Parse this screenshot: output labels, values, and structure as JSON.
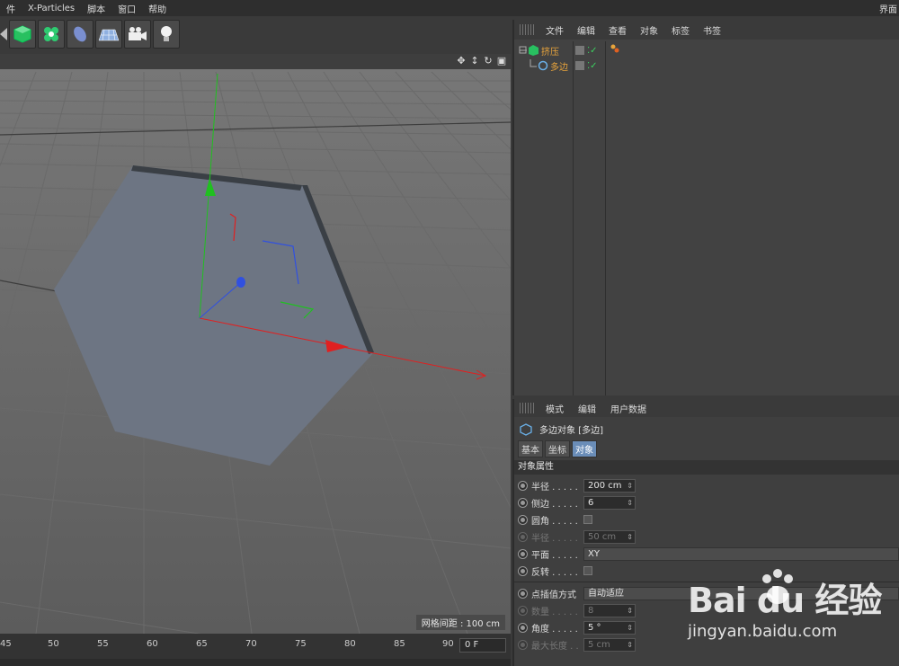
{
  "menu": {
    "items": [
      "件",
      "X-Particles",
      "脚本",
      "窗口",
      "帮助"
    ],
    "right_label": "界面"
  },
  "toolbar": {
    "icons": [
      "extrude-cube-icon",
      "cloner-icon",
      "deformer-icon",
      "floor-grid-icon",
      "camera-icon",
      "light-icon"
    ]
  },
  "viewport": {
    "grid_label": "网格间距 : 100 cm",
    "nav_icons": [
      "move-icon",
      "zoom-icon",
      "rotate-icon",
      "maximize-icon"
    ]
  },
  "timeline": {
    "ticks": [
      "45",
      "50",
      "55",
      "60",
      "65",
      "70",
      "75",
      "80",
      "85",
      "90"
    ],
    "frame_value": "0 F"
  },
  "object_manager": {
    "menu": [
      "文件",
      "编辑",
      "查看",
      "对象",
      "标签",
      "书签"
    ],
    "objects": [
      {
        "name": "挤压",
        "color": "#e8a43c"
      },
      {
        "name": "多边",
        "color": "#e8a43c"
      }
    ]
  },
  "attribute_manager": {
    "menu": [
      "模式",
      "编辑",
      "用户数据"
    ],
    "object_title": "多边对象 [多边]",
    "tabs": [
      "基本",
      "坐标",
      "对象"
    ],
    "active_tab": "对象",
    "section": "对象属性",
    "rows": [
      {
        "label": "半径 . . . . .",
        "value": "200 cm",
        "type": "num",
        "disabled": false
      },
      {
        "label": "侧边 . . . . .",
        "value": "6",
        "type": "num",
        "disabled": false
      },
      {
        "label": "圆角 . . . . .",
        "value": "",
        "type": "check",
        "disabled": false
      },
      {
        "label": "半径 . . . . .",
        "value": "50 cm",
        "type": "num",
        "disabled": true
      },
      {
        "label": "平面 . . . . .",
        "value": "XY",
        "type": "select",
        "disabled": false
      },
      {
        "label": "反转 . . . . .",
        "value": "",
        "type": "check",
        "disabled": false
      },
      {
        "label": "点插值方式",
        "value": "自动适应",
        "type": "select",
        "disabled": false
      },
      {
        "label": "数量 . . . . .",
        "value": "8",
        "type": "num",
        "disabled": true
      },
      {
        "label": "角度 . . . . .",
        "value": "5 °",
        "type": "num",
        "disabled": false
      },
      {
        "label": "最大长度 . .",
        "value": "5 cm",
        "type": "num",
        "disabled": true
      }
    ]
  },
  "watermark": {
    "logo_text": "Bai du 经验",
    "url": "jingyan.baidu.com"
  },
  "colors": {
    "axis_x": "#e02020",
    "axis_y": "#20c020",
    "axis_z": "#3050e0",
    "hexagon": "#6d7583",
    "accent_tab": "#6a8db8"
  }
}
